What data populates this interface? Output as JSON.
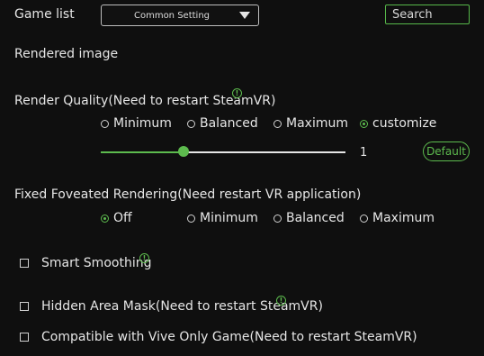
{
  "header": {
    "game_list_label": "Game list",
    "dropdown_value": "Common Setting",
    "search_placeholder": "Search"
  },
  "rendered_image": {
    "heading": "Rendered image"
  },
  "render_quality": {
    "label": "Render Quality(Need to restart SteamVR)",
    "options": [
      "Minimum",
      "Balanced",
      "Maximum",
      "customize"
    ],
    "selected": "customize",
    "slider_value": 0.34,
    "value_text": "1",
    "default_label": "Default"
  },
  "foveated": {
    "label": "Fixed Foveated Rendering(Need restart VR application)",
    "options": [
      "Off",
      "Minimum",
      "Balanced",
      "Maximum"
    ],
    "selected": "Off"
  },
  "checkboxes": {
    "smart_smoothing": "Smart Smoothing",
    "hidden_area_mask": "Hidden Area Mask(Need to restart SteamVR)",
    "vive_only": "Compatible with Vive Only Game(Need to restart SteamVR)"
  },
  "colors": {
    "accent": "#5dbb4e",
    "background": "#0f0f0f"
  },
  "icons": {
    "info": "info-icon",
    "dropdown": "chevron-down-icon"
  }
}
